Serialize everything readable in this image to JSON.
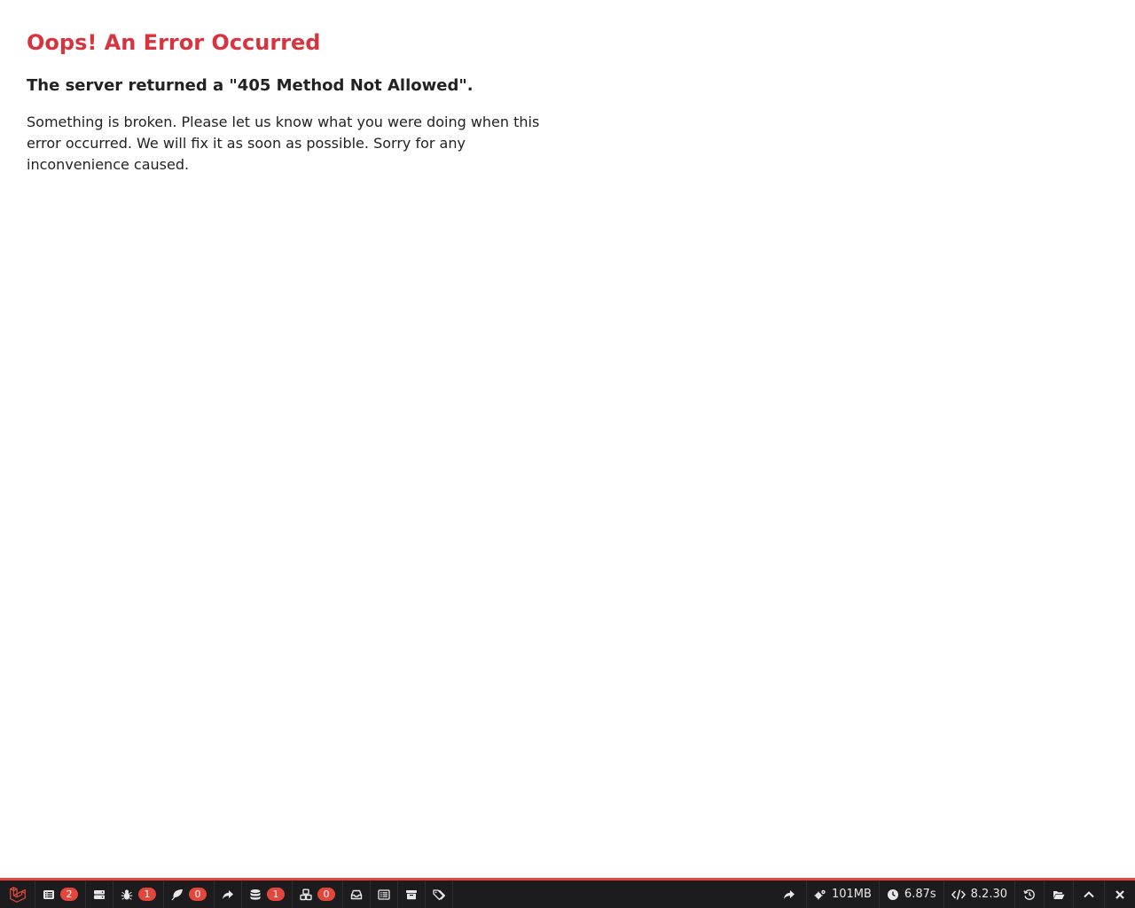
{
  "error": {
    "title": "Oops! An Error Occurred",
    "subtitle": "The server returned a \"405 Method Not Allowed\".",
    "message": "Something is broken. Please let us know what you were doing when this error occurred. We will fix it as soon as possible. Sorry for any inconvenience caused."
  },
  "debugbar": {
    "accent_color": "#e3463c",
    "background_color": "#1c1c1e",
    "left_items": [
      {
        "icon": "laravel-logo-icon"
      },
      {
        "icon": "list-icon",
        "badge": "2"
      },
      {
        "icon": "server-icon"
      },
      {
        "icon": "bug-icon",
        "badge": "1"
      },
      {
        "icon": "leaf-icon",
        "badge": "0"
      },
      {
        "icon": "share-icon"
      },
      {
        "icon": "database-icon",
        "badge": "1"
      },
      {
        "icon": "cubes-icon",
        "badge": "0"
      },
      {
        "icon": "inbox-icon"
      },
      {
        "icon": "list-alt-icon"
      },
      {
        "icon": "archive-icon"
      },
      {
        "icon": "tags-icon"
      }
    ],
    "right_items": {
      "memory": "101MB",
      "time": "6.87s",
      "php_version": "8.2.30"
    }
  }
}
